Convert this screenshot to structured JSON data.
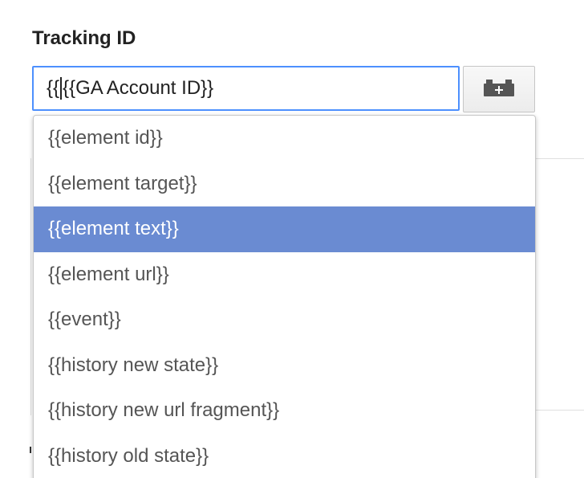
{
  "field": {
    "label": "Tracking ID",
    "value_before_caret": "{{",
    "value_after_caret": "{{GA Account ID}}"
  },
  "variable_button": {
    "icon": "lego-brick-plus-icon",
    "icon_color": "#555555"
  },
  "dropdown": {
    "items": [
      {
        "label": "{{element id}}"
      },
      {
        "label": "{{element target}}"
      },
      {
        "label": "{{element text}}",
        "selected": true
      },
      {
        "label": "{{element url}}"
      },
      {
        "label": "{{event}}"
      },
      {
        "label": "{{history new state}}"
      },
      {
        "label": "{{history new url fragment}}"
      },
      {
        "label": "{{history old state}}"
      }
    ],
    "selected_color": "#6a8bd2"
  },
  "colors": {
    "focus_border": "#4d90fe",
    "label_text": "#222222",
    "item_text": "#555555"
  }
}
